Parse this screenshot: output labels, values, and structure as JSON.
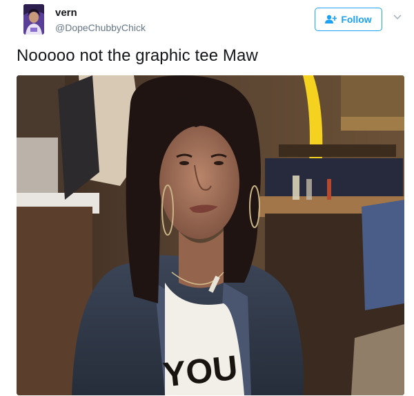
{
  "tweet": {
    "author": {
      "display_name": "vern",
      "handle": "@DopeChubbyChick",
      "avatar_icon": "profile-photo"
    },
    "follow_button": {
      "label": "Follow",
      "icon": "add-user-icon",
      "accent_color": "#1da1f2"
    },
    "menu_icon": "chevron-down-icon",
    "text": "Nooooo not the graphic tee Maw",
    "media": {
      "icon": "photo",
      "shirt_text": "YOU"
    }
  }
}
